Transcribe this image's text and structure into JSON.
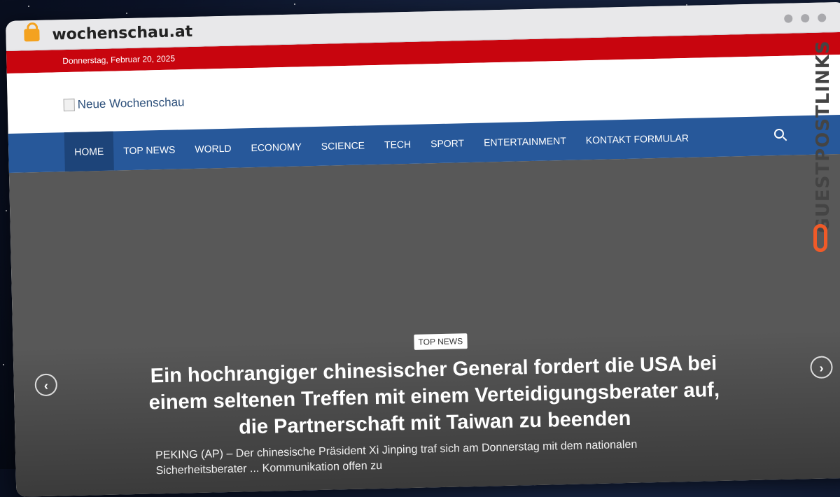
{
  "browser": {
    "url": "wochenschau.at"
  },
  "site": {
    "date": "Donnerstag, Februar 20, 2025",
    "logo_alt": "Neue Wochenschau"
  },
  "nav": {
    "items": [
      {
        "label": "HOME"
      },
      {
        "label": "TOP NEWS"
      },
      {
        "label": "WORLD"
      },
      {
        "label": "ECONOMY"
      },
      {
        "label": "SCIENCE"
      },
      {
        "label": "TECH"
      },
      {
        "label": "SPORT"
      },
      {
        "label": "ENTERTAINMENT"
      },
      {
        "label": "KONTAKT FORMULAR"
      }
    ],
    "active": "HOME"
  },
  "hero": {
    "category": "TOP NEWS",
    "headline": "Ein hochrangiger chinesischer General fordert die USA bei einem seltenen Treffen mit einem Verteidigungsberater auf, die Partnerschaft mit Taiwan zu beenden",
    "excerpt": "PEKING (AP) – Der chinesische Präsident Xi Jinping traf sich am Donnerstag mit dem nationalen Sicherheitsberater ... Kommunikation offen zu"
  },
  "watermark": {
    "text": "GUESTPOSTLINKS"
  },
  "colors": {
    "topbar": "#c8050e",
    "nav": "#27589a",
    "nav_active": "#1d4479",
    "hero_bg": "#585858"
  }
}
